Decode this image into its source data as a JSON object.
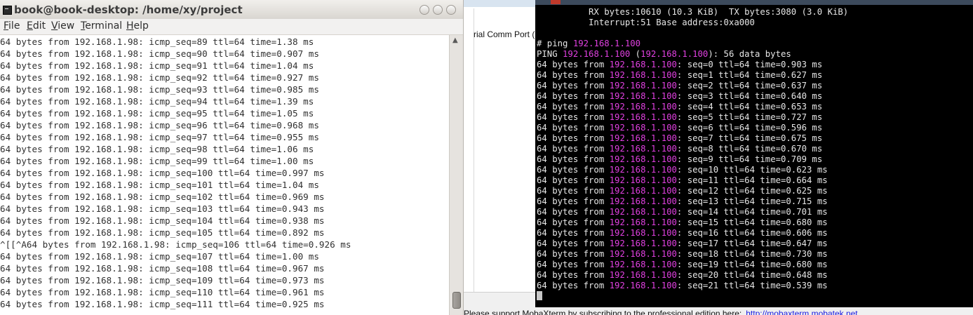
{
  "left_window": {
    "title": "book@book-desktop: /home/xy/project",
    "menu": [
      {
        "label": "File",
        "u": "F",
        "rest": "ile"
      },
      {
        "label": "Edit",
        "u": "E",
        "rest": "dit"
      },
      {
        "label": "View",
        "u": "V",
        "rest": "iew"
      },
      {
        "label": "Terminal",
        "u": "T",
        "rest": "erminal"
      },
      {
        "label": "Help",
        "u": "H",
        "rest": "elp"
      }
    ],
    "lines": [
      "64 bytes from 192.168.1.98: icmp_seq=89 ttl=64 time=1.38 ms",
      "64 bytes from 192.168.1.98: icmp_seq=90 ttl=64 time=0.907 ms",
      "64 bytes from 192.168.1.98: icmp_seq=91 ttl=64 time=1.04 ms",
      "64 bytes from 192.168.1.98: icmp_seq=92 ttl=64 time=0.927 ms",
      "64 bytes from 192.168.1.98: icmp_seq=93 ttl=64 time=0.985 ms",
      "64 bytes from 192.168.1.98: icmp_seq=94 ttl=64 time=1.39 ms",
      "64 bytes from 192.168.1.98: icmp_seq=95 ttl=64 time=1.05 ms",
      "64 bytes from 192.168.1.98: icmp_seq=96 ttl=64 time=0.968 ms",
      "64 bytes from 192.168.1.98: icmp_seq=97 ttl=64 time=0.955 ms",
      "64 bytes from 192.168.1.98: icmp_seq=98 ttl=64 time=1.06 ms",
      "64 bytes from 192.168.1.98: icmp_seq=99 ttl=64 time=1.00 ms",
      "64 bytes from 192.168.1.98: icmp_seq=100 ttl=64 time=0.997 ms",
      "64 bytes from 192.168.1.98: icmp_seq=101 ttl=64 time=1.04 ms",
      "64 bytes from 192.168.1.98: icmp_seq=102 ttl=64 time=0.969 ms",
      "64 bytes from 192.168.1.98: icmp_seq=103 ttl=64 time=0.943 ms",
      "64 bytes from 192.168.1.98: icmp_seq=104 ttl=64 time=0.938 ms",
      "64 bytes from 192.168.1.98: icmp_seq=105 ttl=64 time=0.892 ms",
      "^[[^A64 bytes from 192.168.1.98: icmp_seq=106 ttl=64 time=0.926 ms",
      "64 bytes from 192.168.1.98: icmp_seq=107 ttl=64 time=1.00 ms",
      "64 bytes from 192.168.1.98: icmp_seq=108 ttl=64 time=0.967 ms",
      "64 bytes from 192.168.1.98: icmp_seq=109 ttl=64 time=0.973 ms",
      "64 bytes from 192.168.1.98: icmp_seq=110 ttl=64 time=0.961 ms",
      "64 bytes from 192.168.1.98: icmp_seq=111 ttl=64 time=0.925 ms"
    ]
  },
  "middle_panel": {
    "port_text": "rial Comm Port (C"
  },
  "status_bar": {
    "text": "Please support MobaXterm by subscribing to the professional edition here:",
    "link": "http://mobaxterm.mobatek.net"
  },
  "right_terminal": {
    "header_lines": [
      "          RX bytes:10610 (10.3 KiB)  TX bytes:3080 (3.0 KiB)",
      "          Interrupt:51 Base address:0xa000",
      ""
    ],
    "prompt": "# ping ",
    "target_ip": "192.168.1.100",
    "ping_header": {
      "prefix": "PING ",
      "mid": " (",
      "suffix": "): 56 data bytes"
    },
    "reply_prefix": "64 bytes from ",
    "replies": [
      {
        "seq": 0,
        "ttl": 64,
        "time": "0.903"
      },
      {
        "seq": 1,
        "ttl": 64,
        "time": "0.627"
      },
      {
        "seq": 2,
        "ttl": 64,
        "time": "0.637"
      },
      {
        "seq": 3,
        "ttl": 64,
        "time": "0.640"
      },
      {
        "seq": 4,
        "ttl": 64,
        "time": "0.653"
      },
      {
        "seq": 5,
        "ttl": 64,
        "time": "0.727"
      },
      {
        "seq": 6,
        "ttl": 64,
        "time": "0.596"
      },
      {
        "seq": 7,
        "ttl": 64,
        "time": "0.675"
      },
      {
        "seq": 8,
        "ttl": 64,
        "time": "0.670"
      },
      {
        "seq": 9,
        "ttl": 64,
        "time": "0.709"
      },
      {
        "seq": 10,
        "ttl": 64,
        "time": "0.623"
      },
      {
        "seq": 11,
        "ttl": 64,
        "time": "0.664"
      },
      {
        "seq": 12,
        "ttl": 64,
        "time": "0.625"
      },
      {
        "seq": 13,
        "ttl": 64,
        "time": "0.715"
      },
      {
        "seq": 14,
        "ttl": 64,
        "time": "0.701"
      },
      {
        "seq": 15,
        "ttl": 64,
        "time": "0.680"
      },
      {
        "seq": 16,
        "ttl": 64,
        "time": "0.606"
      },
      {
        "seq": 17,
        "ttl": 64,
        "time": "0.647"
      },
      {
        "seq": 18,
        "ttl": 64,
        "time": "0.730"
      },
      {
        "seq": 19,
        "ttl": 64,
        "time": "0.680"
      },
      {
        "seq": 20,
        "ttl": 64,
        "time": "0.648"
      },
      {
        "seq": 21,
        "ttl": 64,
        "time": "0.539"
      }
    ]
  },
  "colors": {
    "ip_highlight": "#e040e0",
    "terminal_bg": "#000000",
    "terminal_fg": "#e6e6e6"
  },
  "icons": [
    "terminal-icon",
    "minimize-icon",
    "maximize-icon",
    "close-icon",
    "scroll-up-icon"
  ]
}
